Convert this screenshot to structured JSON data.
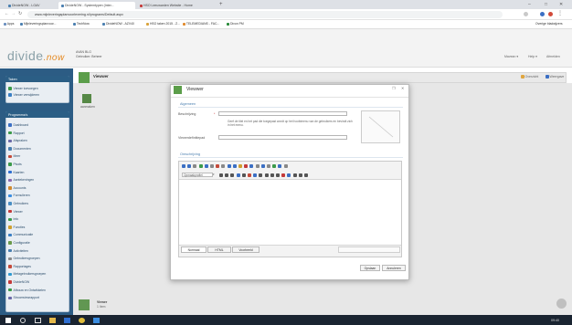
{
  "browser": {
    "tabs": [
      {
        "label": "DivideNOW - LGAV",
        "active": false
      },
      {
        "label": "DivideNOW - Systemtypen (Inter...",
        "active": true
      },
      {
        "label": "HSO Leeuwarden Website - Home",
        "active": false
      }
    ],
    "new_tab": "+",
    "url": "www.mijnleveringsplanvoorlevering.nl/programs/Default.aspx",
    "bookmarks": [
      "Apps",
      "Mijnleveringsplanvoor...",
      "TechNow",
      "DivideNOW - AZV40",
      "HSO taken 2015 - Z...",
      "TELEMEDIANS - FAC...",
      "Divon PM"
    ],
    "bookmarks_right": "Overige bladwijzers"
  },
  "app": {
    "logo_main": "divide",
    "logo_suffix": ".now",
    "org_line1": "AVAN BLG",
    "org_line2": "Gebruiker: Beheer",
    "nav_right": [
      "Mavean ▾",
      "Help ▾",
      "Afmelden"
    ],
    "viewer_title": "Viewwer",
    "viewer_actions": [
      "Overzicht",
      "Weergave"
    ],
    "item_label": "aanmaken",
    "footer_title": "Viewer",
    "footer_sub": "1 Item"
  },
  "sidebar": {
    "taken_title": "Taken",
    "taken_items": [
      "Viewer toevoegen",
      "Viewer verwijderen"
    ],
    "programs_title": "Programma's",
    "program_items": [
      "Dashboard",
      "Rapport",
      "Afspraken",
      "Documenten",
      "Meer",
      "Pivots",
      "Kaarten",
      "Aantekeningen",
      "Accounts",
      "Formulieren",
      "Gebruikers",
      "Viewer",
      "Info",
      "Functies",
      "Communicatie",
      "Configuratie",
      "Activiteiten",
      "Gebruikersgroepen",
      "Rapportages",
      "Metagebruikersgroepen",
      "DivideNOW",
      "Afbouw en Ontwikkelen",
      "Stroomviewrapport"
    ]
  },
  "modal": {
    "title": "Viewwer",
    "section_general": "Algemeen",
    "label_name": "Beschrijving",
    "required": "*",
    "name_value": "",
    "hint": "Geef de titel en het pad die toegepast wordt op het hoofdmenu van de gebruikers en bevindt zich in het menu.",
    "label_url": "Viewerdefinitiepad",
    "url_value": "",
    "section_desc": "Omschrijving",
    "style_placeholder": "Opmaakprofiel",
    "editor_tabs": [
      "Normaal",
      "HTML",
      "Voorbeeld"
    ],
    "btn_save": "Opslaan",
    "btn_cancel": "Annuleren",
    "ctrl_restore": "❐",
    "ctrl_close": "✕"
  },
  "taskbar": {
    "clock": "09:40"
  }
}
